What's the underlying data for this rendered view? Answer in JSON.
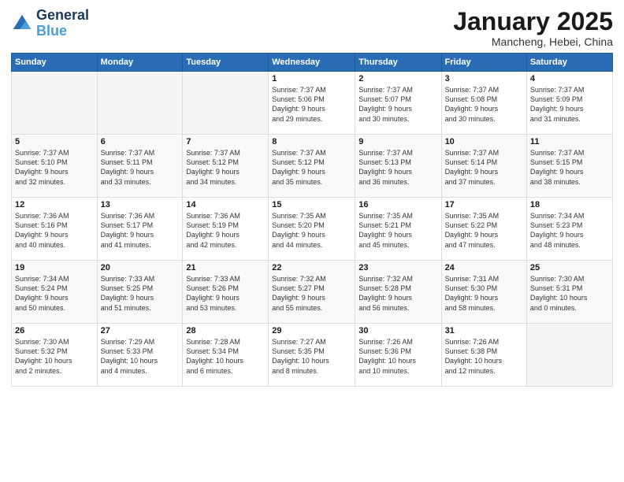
{
  "header": {
    "logo_line1": "General",
    "logo_line2": "Blue",
    "month": "January 2025",
    "location": "Mancheng, Hebei, China"
  },
  "weekdays": [
    "Sunday",
    "Monday",
    "Tuesday",
    "Wednesday",
    "Thursday",
    "Friday",
    "Saturday"
  ],
  "weeks": [
    [
      {
        "day": "",
        "info": ""
      },
      {
        "day": "",
        "info": ""
      },
      {
        "day": "",
        "info": ""
      },
      {
        "day": "1",
        "info": "Sunrise: 7:37 AM\nSunset: 5:06 PM\nDaylight: 9 hours\nand 29 minutes."
      },
      {
        "day": "2",
        "info": "Sunrise: 7:37 AM\nSunset: 5:07 PM\nDaylight: 9 hours\nand 30 minutes."
      },
      {
        "day": "3",
        "info": "Sunrise: 7:37 AM\nSunset: 5:08 PM\nDaylight: 9 hours\nand 30 minutes."
      },
      {
        "day": "4",
        "info": "Sunrise: 7:37 AM\nSunset: 5:09 PM\nDaylight: 9 hours\nand 31 minutes."
      }
    ],
    [
      {
        "day": "5",
        "info": "Sunrise: 7:37 AM\nSunset: 5:10 PM\nDaylight: 9 hours\nand 32 minutes."
      },
      {
        "day": "6",
        "info": "Sunrise: 7:37 AM\nSunset: 5:11 PM\nDaylight: 9 hours\nand 33 minutes."
      },
      {
        "day": "7",
        "info": "Sunrise: 7:37 AM\nSunset: 5:12 PM\nDaylight: 9 hours\nand 34 minutes."
      },
      {
        "day": "8",
        "info": "Sunrise: 7:37 AM\nSunset: 5:12 PM\nDaylight: 9 hours\nand 35 minutes."
      },
      {
        "day": "9",
        "info": "Sunrise: 7:37 AM\nSunset: 5:13 PM\nDaylight: 9 hours\nand 36 minutes."
      },
      {
        "day": "10",
        "info": "Sunrise: 7:37 AM\nSunset: 5:14 PM\nDaylight: 9 hours\nand 37 minutes."
      },
      {
        "day": "11",
        "info": "Sunrise: 7:37 AM\nSunset: 5:15 PM\nDaylight: 9 hours\nand 38 minutes."
      }
    ],
    [
      {
        "day": "12",
        "info": "Sunrise: 7:36 AM\nSunset: 5:16 PM\nDaylight: 9 hours\nand 40 minutes."
      },
      {
        "day": "13",
        "info": "Sunrise: 7:36 AM\nSunset: 5:17 PM\nDaylight: 9 hours\nand 41 minutes."
      },
      {
        "day": "14",
        "info": "Sunrise: 7:36 AM\nSunset: 5:19 PM\nDaylight: 9 hours\nand 42 minutes."
      },
      {
        "day": "15",
        "info": "Sunrise: 7:35 AM\nSunset: 5:20 PM\nDaylight: 9 hours\nand 44 minutes."
      },
      {
        "day": "16",
        "info": "Sunrise: 7:35 AM\nSunset: 5:21 PM\nDaylight: 9 hours\nand 45 minutes."
      },
      {
        "day": "17",
        "info": "Sunrise: 7:35 AM\nSunset: 5:22 PM\nDaylight: 9 hours\nand 47 minutes."
      },
      {
        "day": "18",
        "info": "Sunrise: 7:34 AM\nSunset: 5:23 PM\nDaylight: 9 hours\nand 48 minutes."
      }
    ],
    [
      {
        "day": "19",
        "info": "Sunrise: 7:34 AM\nSunset: 5:24 PM\nDaylight: 9 hours\nand 50 minutes."
      },
      {
        "day": "20",
        "info": "Sunrise: 7:33 AM\nSunset: 5:25 PM\nDaylight: 9 hours\nand 51 minutes."
      },
      {
        "day": "21",
        "info": "Sunrise: 7:33 AM\nSunset: 5:26 PM\nDaylight: 9 hours\nand 53 minutes."
      },
      {
        "day": "22",
        "info": "Sunrise: 7:32 AM\nSunset: 5:27 PM\nDaylight: 9 hours\nand 55 minutes."
      },
      {
        "day": "23",
        "info": "Sunrise: 7:32 AM\nSunset: 5:28 PM\nDaylight: 9 hours\nand 56 minutes."
      },
      {
        "day": "24",
        "info": "Sunrise: 7:31 AM\nSunset: 5:30 PM\nDaylight: 9 hours\nand 58 minutes."
      },
      {
        "day": "25",
        "info": "Sunrise: 7:30 AM\nSunset: 5:31 PM\nDaylight: 10 hours\nand 0 minutes."
      }
    ],
    [
      {
        "day": "26",
        "info": "Sunrise: 7:30 AM\nSunset: 5:32 PM\nDaylight: 10 hours\nand 2 minutes."
      },
      {
        "day": "27",
        "info": "Sunrise: 7:29 AM\nSunset: 5:33 PM\nDaylight: 10 hours\nand 4 minutes."
      },
      {
        "day": "28",
        "info": "Sunrise: 7:28 AM\nSunset: 5:34 PM\nDaylight: 10 hours\nand 6 minutes."
      },
      {
        "day": "29",
        "info": "Sunrise: 7:27 AM\nSunset: 5:35 PM\nDaylight: 10 hours\nand 8 minutes."
      },
      {
        "day": "30",
        "info": "Sunrise: 7:26 AM\nSunset: 5:36 PM\nDaylight: 10 hours\nand 10 minutes."
      },
      {
        "day": "31",
        "info": "Sunrise: 7:26 AM\nSunset: 5:38 PM\nDaylight: 10 hours\nand 12 minutes."
      },
      {
        "day": "",
        "info": ""
      }
    ]
  ]
}
